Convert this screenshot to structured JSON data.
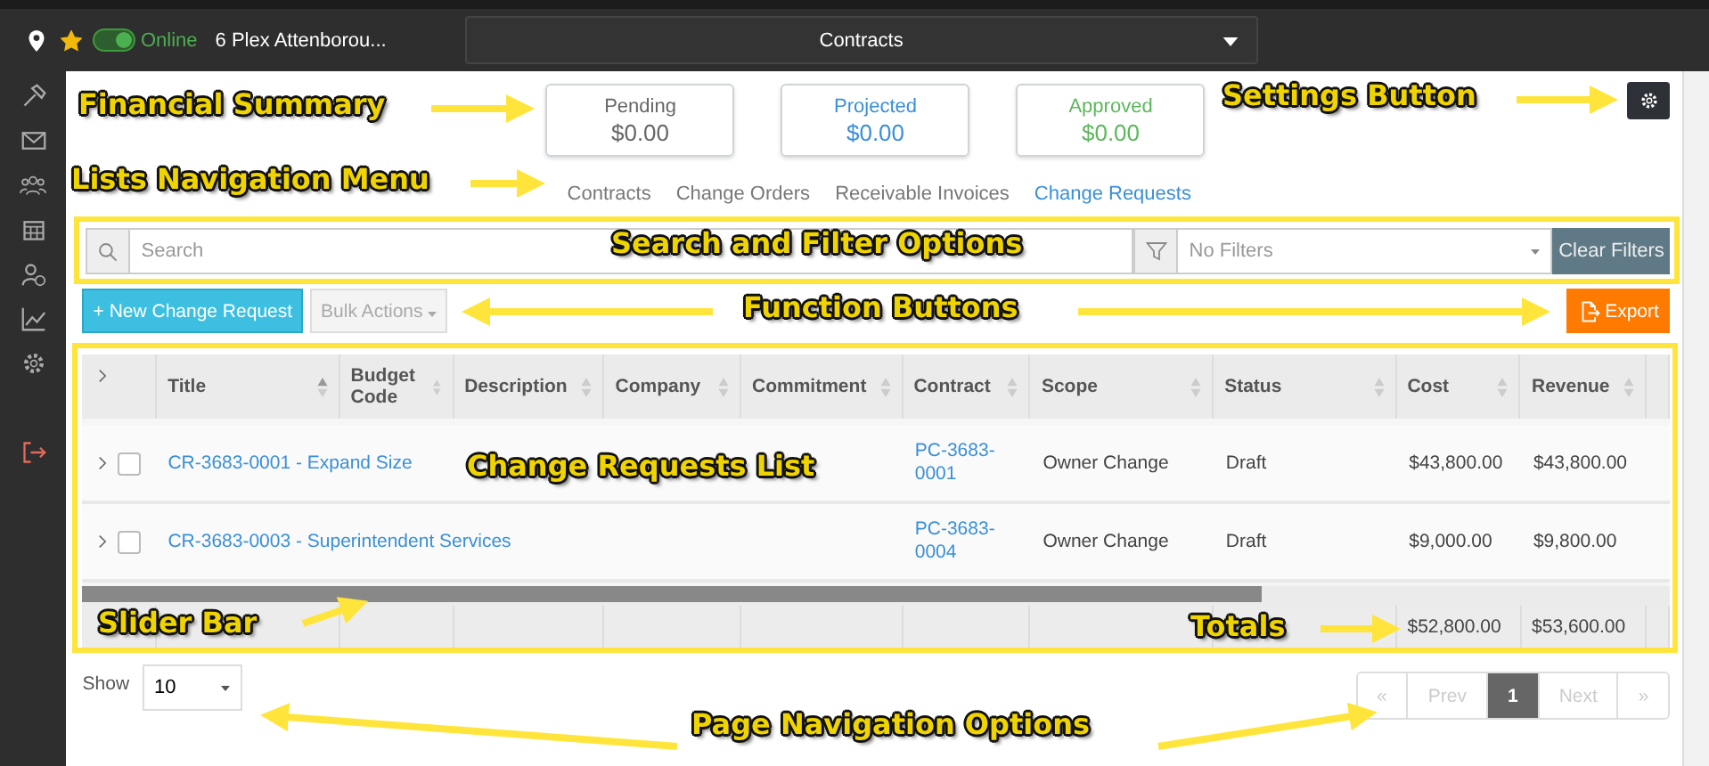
{
  "topbar": {
    "favorite": true,
    "status": {
      "label": "Online",
      "on": true
    },
    "project": "6 Plex Attenborou...",
    "section_dropdown": "Contracts"
  },
  "summary": [
    {
      "label": "Pending",
      "value": "$0.00",
      "color": "#666666"
    },
    {
      "label": "Projected",
      "value": "$0.00",
      "color": "#3a8fd6"
    },
    {
      "label": "Approved",
      "value": "$0.00",
      "color": "#5cb85c"
    }
  ],
  "nav": [
    {
      "label": "Contracts",
      "selected": false
    },
    {
      "label": "Change Orders",
      "selected": false
    },
    {
      "label": "Receivable Invoices",
      "selected": false
    },
    {
      "label": "Change Requests",
      "selected": true
    }
  ],
  "search": {
    "placeholder": "Search",
    "filter_placeholder": "No Filters",
    "clear_button": "Clear Filters"
  },
  "actions": {
    "new_button": "+ New Change Request",
    "bulk_button": "Bulk Actions",
    "export_button": "Export"
  },
  "table": {
    "columns": [
      {
        "label": "Title",
        "sorted": true
      },
      {
        "label": "Budget Code",
        "sorted": false
      },
      {
        "label": "Description",
        "sorted": false
      },
      {
        "label": "Company",
        "sorted": false
      },
      {
        "label": "Commitment",
        "sorted": false
      },
      {
        "label": "Contract",
        "sorted": false
      },
      {
        "label": "Scope",
        "sorted": false
      },
      {
        "label": "Status",
        "sorted": false
      },
      {
        "label": "Cost",
        "sorted": false
      },
      {
        "label": "Revenue",
        "sorted": false
      }
    ],
    "rows": [
      {
        "checked": false,
        "title": "CR-3683-0001 - Expand Size",
        "contract": "PC-3683-0001",
        "scope": "Owner Change",
        "status": "Draft",
        "cost": "$43,800.00",
        "revenue": "$43,800.00"
      },
      {
        "checked": false,
        "title": "CR-3683-0003 - Superintendent Services",
        "contract": "PC-3683-0004",
        "scope": "Owner Change",
        "status": "Draft",
        "cost": "$9,000.00",
        "revenue": "$9,800.00"
      }
    ],
    "totals": {
      "cost": "$52,800.00",
      "revenue": "$53,600.00"
    }
  },
  "footer": {
    "show_label": "Show",
    "page_size": "10",
    "pages": [
      {
        "label": "«",
        "selected": false,
        "disabled": true
      },
      {
        "label": "Prev",
        "selected": false,
        "disabled": true
      },
      {
        "label": "1",
        "selected": true,
        "disabled": false
      },
      {
        "label": "Next",
        "selected": false,
        "disabled": true
      },
      {
        "label": "»",
        "selected": false,
        "disabled": true
      }
    ]
  },
  "annotations": [
    {
      "text": "Financial Summary"
    },
    {
      "text": "Lists Navigation Menu"
    },
    {
      "text": "Settings Button"
    },
    {
      "text": "Search and Filter Options"
    },
    {
      "text": "Function Buttons"
    },
    {
      "text": "Change Requests List"
    },
    {
      "text": "Slider Bar"
    },
    {
      "text": "Totals"
    },
    {
      "text": "Page Navigation Options"
    }
  ]
}
